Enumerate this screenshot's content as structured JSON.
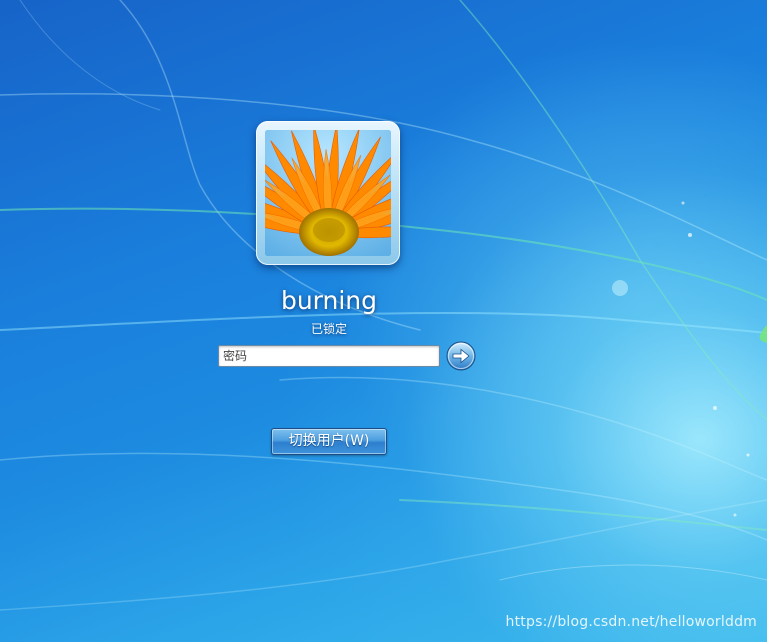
{
  "user": {
    "name": "burning",
    "status": "已锁定",
    "avatar_icon": "flower-avatar-icon"
  },
  "password": {
    "placeholder": "密码",
    "value": ""
  },
  "submit": {
    "icon": "arrow-right-icon"
  },
  "actions": {
    "switch_user_label": "切换用户(W)"
  },
  "watermark": {
    "text": "https://blog.csdn.net/helloworlddm"
  },
  "colors": {
    "background_top": "#1763c8",
    "background_glow": "#aaf0ff",
    "button_blue": "#3e93da",
    "avatar_orange": "#ff7a00"
  }
}
